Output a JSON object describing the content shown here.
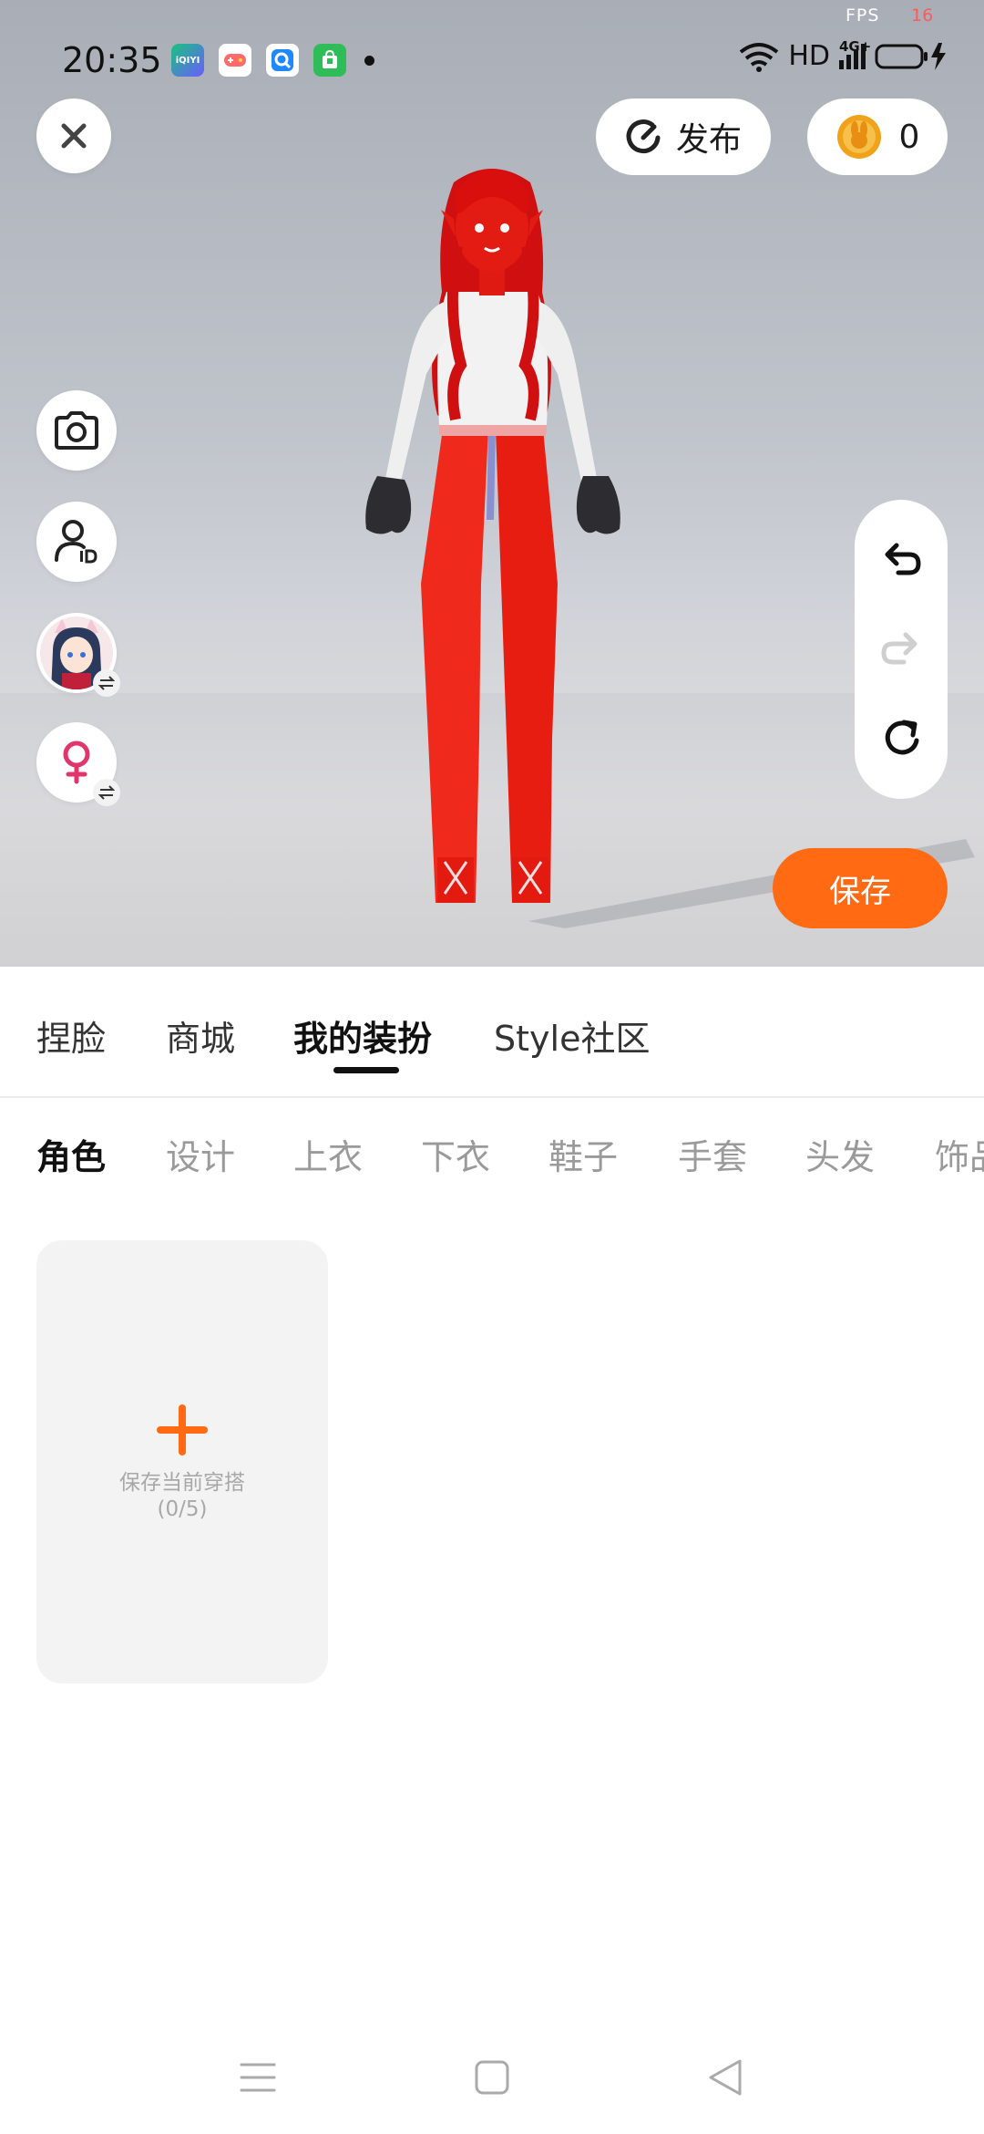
{
  "status_bar": {
    "fps_label": "FPS",
    "fps_value": "16",
    "time": "20:35",
    "app_icons": [
      "iqiyi-icon",
      "game-icon",
      "browser-icon",
      "store-icon"
    ],
    "iqiyi_text": "iQIYI",
    "hd_label": "HD",
    "network_label": "4G+"
  },
  "top_bar": {
    "publish_label": "发布",
    "coin_count": "0"
  },
  "side_tools": [
    "camera-icon",
    "user-id-icon",
    "avatar-switch",
    "gender-switch-icon"
  ],
  "edit_history": [
    "undo-icon",
    "redo-icon",
    "reset-icon"
  ],
  "save_button_label": "保存",
  "main_tabs": [
    {
      "label": "捏脸",
      "active": false
    },
    {
      "label": "商城",
      "active": false
    },
    {
      "label": "我的装扮",
      "active": true
    },
    {
      "label": "Style社区",
      "active": false
    }
  ],
  "sub_tabs": [
    {
      "label": "角色",
      "active": true
    },
    {
      "label": "设计",
      "active": false
    },
    {
      "label": "上衣",
      "active": false
    },
    {
      "label": "下衣",
      "active": false
    },
    {
      "label": "鞋子",
      "active": false
    },
    {
      "label": "手套",
      "active": false
    },
    {
      "label": "头发",
      "active": false
    },
    {
      "label": "饰品",
      "active": false
    }
  ],
  "outfit_card": {
    "title": "保存当前穿搭",
    "count": "(0/5)"
  },
  "colors": {
    "accent": "#ff6a13",
    "character_red": "#e8140d"
  }
}
